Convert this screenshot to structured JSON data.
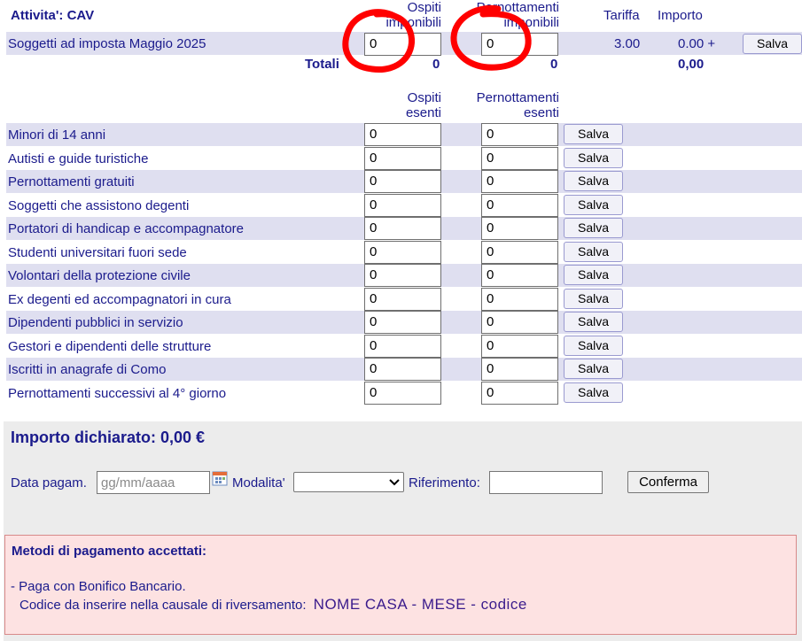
{
  "header": {
    "activity_label": "Attivita': CAV",
    "col_ospiti_imponibili": [
      "Ospiti",
      "imponibili"
    ],
    "col_pernottamenti_imponibili": [
      "Pernottamenti",
      "imponibili"
    ],
    "col_tariffa": "Tariffa",
    "col_importo": "Importo"
  },
  "taxable_row": {
    "label": "Soggetti ad imposta Maggio 2025",
    "ospiti": "0",
    "pernottamenti": "0",
    "tariffa": "3.00",
    "importo": "0.00 +",
    "save_label": "Salva"
  },
  "totals": {
    "label": "Totali",
    "ospiti": "0",
    "pernottamenti": "0",
    "importo": "0,00"
  },
  "exempt_header": {
    "col_ospiti_esenti": [
      "Ospiti",
      "esenti"
    ],
    "col_pernottamenti_esenti": [
      "Pernottamenti",
      "esenti"
    ]
  },
  "exempt_rows": [
    {
      "label": "Minori di 14 anni",
      "ospiti": "0",
      "pernottamenti": "0",
      "save_label": "Salva"
    },
    {
      "label": "Autisti e guide turistiche",
      "ospiti": "0",
      "pernottamenti": "0",
      "save_label": "Salva"
    },
    {
      "label": "Pernottamenti gratuiti",
      "ospiti": "0",
      "pernottamenti": "0",
      "save_label": "Salva"
    },
    {
      "label": "Soggetti che assistono degenti",
      "ospiti": "0",
      "pernottamenti": "0",
      "save_label": "Salva"
    },
    {
      "label": "Portatori di handicap e accompagnatore",
      "ospiti": "0",
      "pernottamenti": "0",
      "save_label": "Salva"
    },
    {
      "label": "Studenti universitari fuori sede",
      "ospiti": "0",
      "pernottamenti": "0",
      "save_label": "Salva"
    },
    {
      "label": "Volontari della protezione civile",
      "ospiti": "0",
      "pernottamenti": "0",
      "save_label": "Salva"
    },
    {
      "label": "Ex degenti ed accompagnatori in cura",
      "ospiti": "0",
      "pernottamenti": "0",
      "save_label": "Salva"
    },
    {
      "label": "Dipendenti pubblici in servizio",
      "ospiti": "0",
      "pernottamenti": "0",
      "save_label": "Salva"
    },
    {
      "label": "Gestori e dipendenti delle strutture",
      "ospiti": "0",
      "pernottamenti": "0",
      "save_label": "Salva"
    },
    {
      "label": "Iscritti in anagrafe di Como",
      "ospiti": "0",
      "pernottamenti": "0",
      "save_label": "Salva"
    },
    {
      "label": "Pernottamenti successivi al 4° giorno",
      "ospiti": "0",
      "pernottamenti": "0",
      "save_label": "Salva"
    }
  ],
  "declared": {
    "label": "Importo dichiarato: 0,00 €"
  },
  "payment_form": {
    "date_label": "Data pagam.",
    "date_placeholder": "gg/mm/aaaa",
    "modality_label": "Modalita'",
    "modality_value": "",
    "reference_label": "Riferimento:",
    "reference_value": "",
    "confirm_label": "Conferma"
  },
  "payment_methods": {
    "title": "Metodi di pagamento accettati:",
    "line1": "- Paga con Bonifico Bancario.",
    "line2_prefix": "Codice da inserire nella causale di riversamento:",
    "line2_code": "NOME CASA - MESE - codice"
  },
  "colors": {
    "text": "#1b1b8c",
    "stripe": "#dfdff0",
    "annotation": "#ff0000",
    "pink_box": "#fde2e2"
  },
  "icons": {
    "calendar": "calendar-icon",
    "select": "chevron-down-icon"
  }
}
